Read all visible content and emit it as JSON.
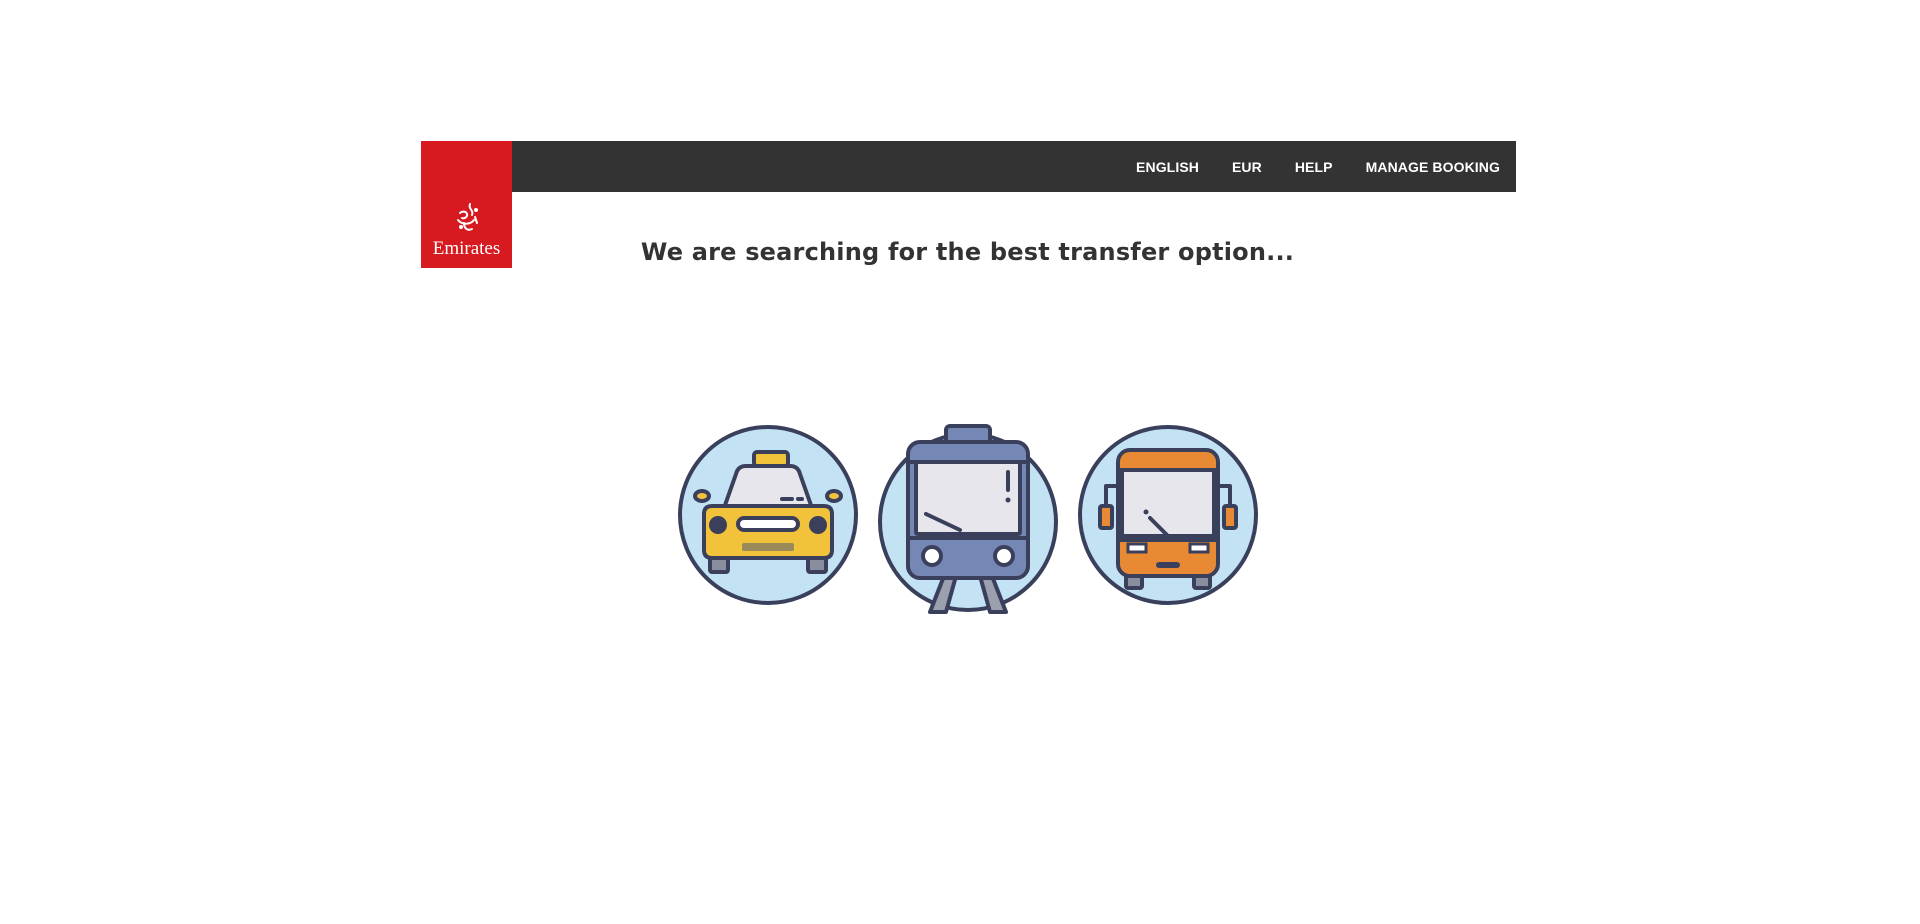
{
  "header": {
    "brand": "Emirates",
    "nav": [
      "ENGLISH",
      "EUR",
      "HELP",
      "MANAGE BOOKING"
    ]
  },
  "main": {
    "headline": "We are searching for the best transfer option...",
    "icons": [
      "taxi-icon",
      "tram-icon",
      "bus-icon"
    ]
  },
  "colors": {
    "brand_red": "#d71920",
    "topbar": "#333333",
    "circle_fill": "#c3e3f5",
    "outline": "#3a3f5c",
    "taxi_yellow": "#f2c23a",
    "tram_blue": "#7587b5",
    "bus_orange": "#e88a33"
  }
}
